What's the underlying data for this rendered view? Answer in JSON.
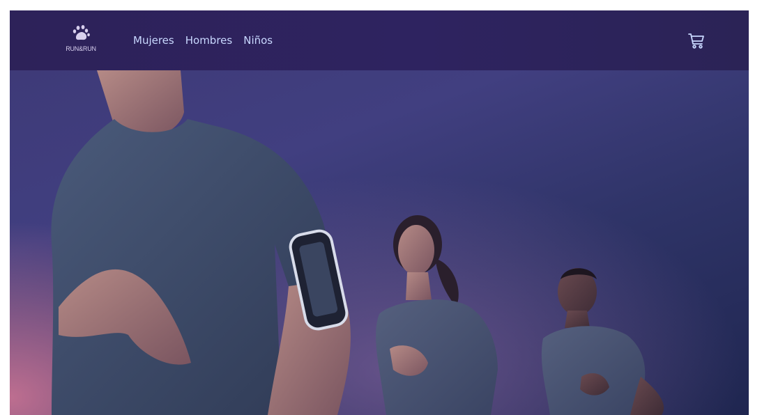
{
  "brand": {
    "logo_text": "RUN&RUN",
    "logo_icon": "paw-icon"
  },
  "nav": {
    "items": [
      {
        "label": "Mujeres"
      },
      {
        "label": "Hombres"
      },
      {
        "label": "Niños"
      }
    ]
  },
  "cart": {
    "icon": "cart-icon"
  },
  "hero": {
    "image": "runners-hero-image"
  },
  "colors": {
    "navbar": "#2d2259",
    "nav_text": "#c9d8ff",
    "logo_text": "#d8d0ee"
  }
}
